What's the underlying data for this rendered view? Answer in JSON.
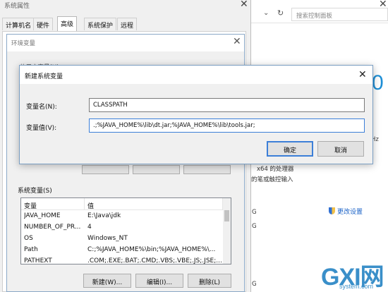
{
  "background_panel": {
    "search_placeholder": "搜索控制面板",
    "big_number": "0",
    "ghz": "Hz",
    "x64_text": "x64 的处理器",
    "pen_text": "的笔或触控输入",
    "g1": "G",
    "g2": "G",
    "g3": "G",
    "change_settings": "更改设置"
  },
  "system_properties": {
    "title": "系统属性",
    "tabs": [
      {
        "label": "计算机名"
      },
      {
        "label": "硬件"
      },
      {
        "label": "高级"
      },
      {
        "label": "系统保护"
      },
      {
        "label": "远程"
      }
    ],
    "active_tab": "高级"
  },
  "env_window": {
    "title": "环境变量",
    "user_vars_label": "的用户变量(U)",
    "system_vars_label": "系统变量(S)",
    "columns": [
      "变量",
      "值"
    ],
    "rows": [
      {
        "name": "JAVA_HOME",
        "value": "E:\\Java\\jdk"
      },
      {
        "name": "NUMBER_OF_PR...",
        "value": "4"
      },
      {
        "name": "OS",
        "value": "Windows_NT"
      },
      {
        "name": "Path",
        "value": "C:;%JAVA_HOME%\\bin;%JAVA_HOME%\\..."
      },
      {
        "name": "PATHEXT",
        "value": ".COM;.EXE;.BAT;.CMD;.VBS;.VBE;.JS;.JSE;..."
      }
    ],
    "buttons": {
      "new": "新建(W)...",
      "edit": "编辑(I)...",
      "delete": "删除(L)"
    }
  },
  "new_variable_dialog": {
    "title": "新建系统变量",
    "name_label": "变量名(N):",
    "value_label": "变量值(V):",
    "name_value": "CLASSPATH",
    "value_value": ".;%JAVA_HOME%\\lib\\dt.jar;%JAVA_HOME%\\lib\\tools.jar;",
    "ok": "确定",
    "cancel": "取消"
  },
  "watermark": {
    "main": "GXI网",
    "sub": "system.com"
  }
}
